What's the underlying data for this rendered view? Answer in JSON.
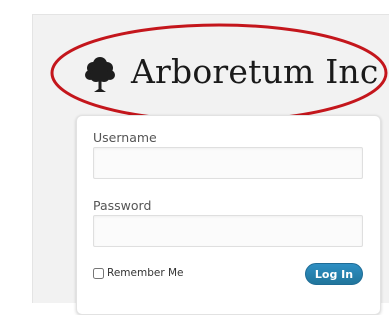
{
  "brand": {
    "name": "Arboretum Inc",
    "logo_icon": "tree-icon",
    "annotation_color": "#c4161c"
  },
  "login": {
    "username_label": "Username",
    "username_value": "",
    "password_label": "Password",
    "password_value": "",
    "remember_label": "Remember Me",
    "remember_checked": false,
    "submit_label": "Log In",
    "submit_color": "#21759b"
  }
}
